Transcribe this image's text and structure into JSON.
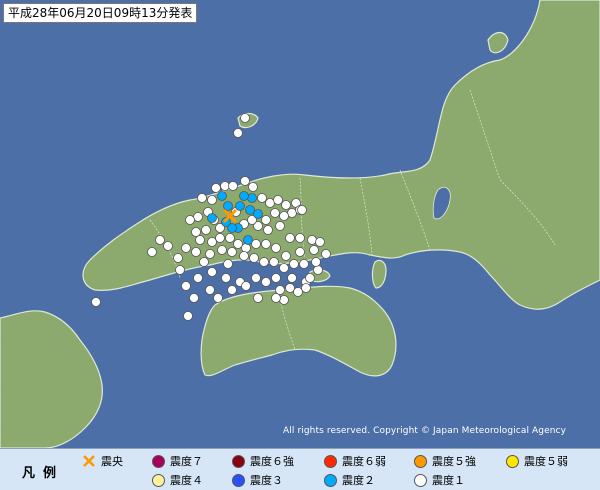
{
  "title": "平成28年06月20日09時13分発表",
  "copyright": "All rights reserved. Copyright © Japan Meteorological Agency",
  "legend": {
    "label": "凡例",
    "items": [
      {
        "label": "震央",
        "symbol": "epicenter-cross",
        "color": "#ff9900"
      },
      {
        "label": "震度７",
        "color": "#a8005a"
      },
      {
        "label": "震度６強",
        "color": "#8c0010"
      },
      {
        "label": "震度６弱",
        "color": "#ff2800"
      },
      {
        "label": "震度５強",
        "color": "#ff9900"
      },
      {
        "label": "震度５弱",
        "color": "#ffe600"
      },
      {
        "label": "震度４",
        "color": "#fff0a0"
      },
      {
        "label": "震度３",
        "color": "#2850ff"
      },
      {
        "label": "震度２",
        "color": "#00aaff"
      },
      {
        "label": "震度１",
        "color": "#ffffff"
      }
    ]
  },
  "colors": {
    "sea": "#4d6fa8",
    "land": "#8caa6e",
    "coast": "#dfe8d5",
    "epicenter": "#ff9900",
    "intensity1": "#ffffff",
    "intensity2": "#00aaff"
  }
}
